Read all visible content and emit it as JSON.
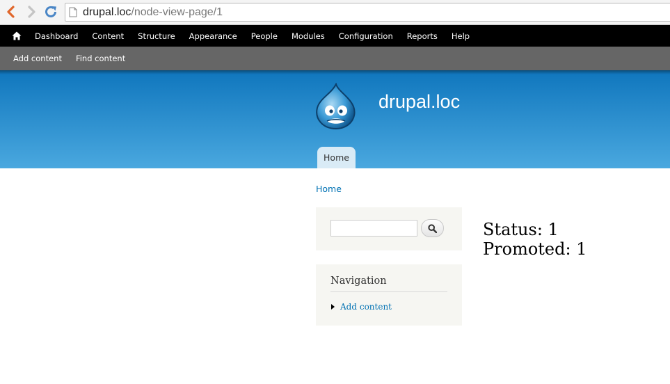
{
  "browser": {
    "url_host": "drupal.loc",
    "url_path": "/node-view-page/1"
  },
  "admin_toolbar": {
    "items": [
      "Dashboard",
      "Content",
      "Structure",
      "Appearance",
      "People",
      "Modules",
      "Configuration",
      "Reports",
      "Help"
    ],
    "shortcuts": [
      "Add content",
      "Find content"
    ]
  },
  "header": {
    "site_name": "drupal.loc",
    "main_menu": [
      "Home"
    ],
    "colors": {
      "gradient_top": "#0f76bd",
      "gradient_bottom": "#4aa8df",
      "link": "#0071b3"
    }
  },
  "breadcrumb": "Home",
  "sidebar": {
    "search": {
      "value": "",
      "button_icon": "search-icon"
    },
    "navigation": {
      "title": "Navigation",
      "items": [
        "Add content"
      ]
    }
  },
  "content": {
    "lines": [
      "Status: 1",
      "Promoted: 1"
    ]
  }
}
